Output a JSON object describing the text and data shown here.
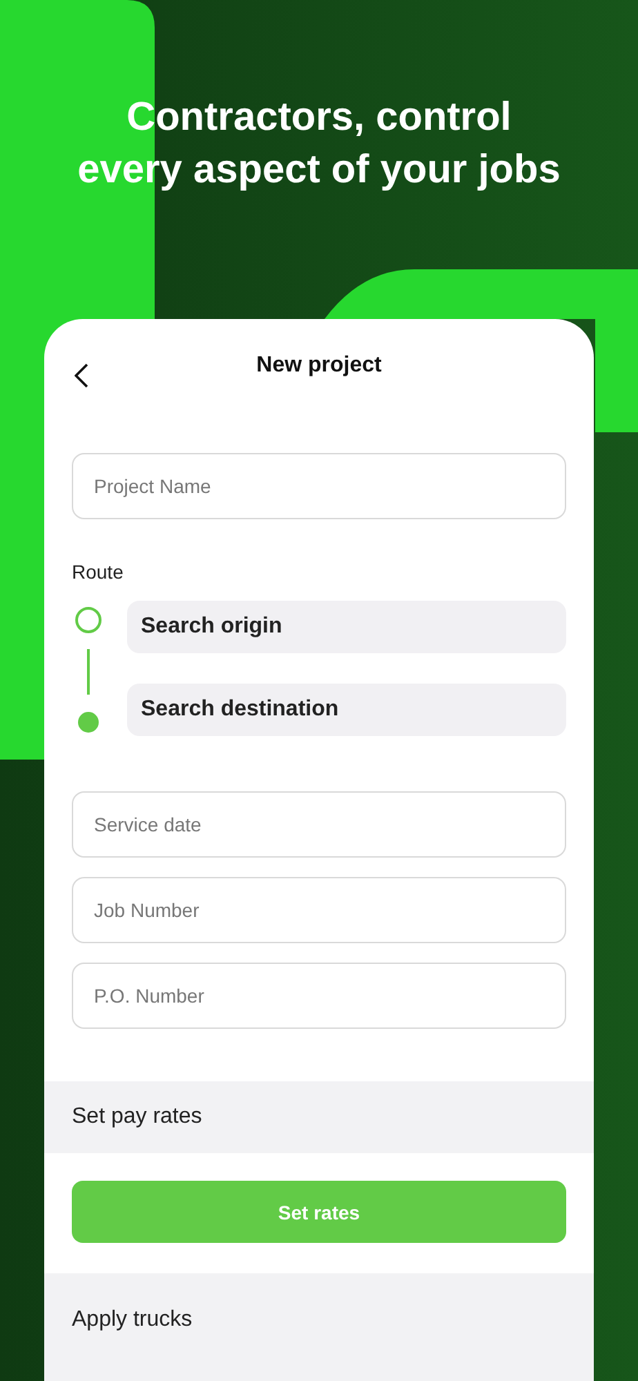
{
  "headline": [
    "Contractors, control",
    "every aspect of your jobs"
  ],
  "screen": {
    "title": "New project",
    "top_fields": [
      {
        "placeholder": "Project Name"
      }
    ],
    "route": {
      "label": "Route",
      "stops": [
        {
          "kind": "origin",
          "label": "Search origin"
        },
        {
          "kind": "destination",
          "label": "Search destination"
        }
      ]
    },
    "fields": [
      {
        "placeholder": "Service date"
      },
      {
        "placeholder": "Job Number"
      },
      {
        "placeholder": "P.O. Number"
      }
    ],
    "pay_section": {
      "title": "Set pay rates",
      "button": "Set rates"
    },
    "trucks_section": {
      "title": "Apply trucks"
    }
  }
}
